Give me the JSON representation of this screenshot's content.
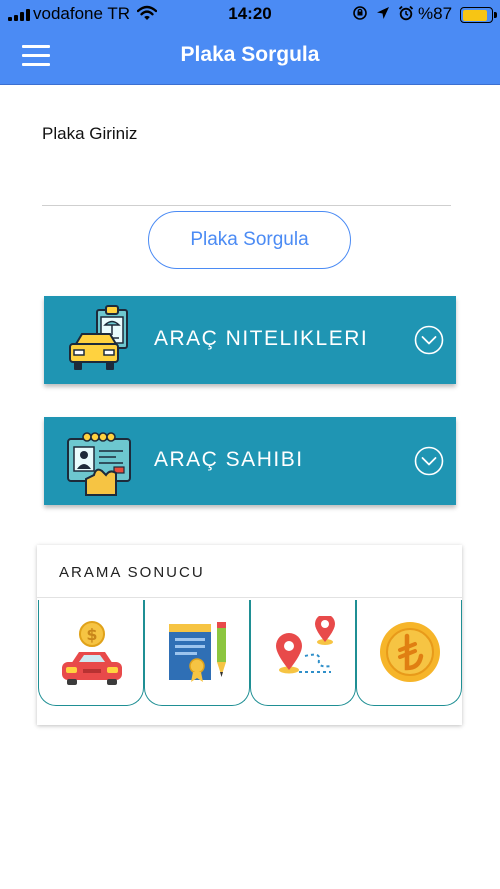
{
  "status_bar": {
    "carrier": "vodafone TR",
    "time": "14:20",
    "battery_percent": "%87"
  },
  "app_bar": {
    "title": "Plaka Sorgula",
    "menu_icon": "hamburger-menu-icon"
  },
  "form": {
    "plate_label": "Plaka Giriniz",
    "plate_value": "",
    "query_button_label": "Plaka Sorgula"
  },
  "panels": [
    {
      "title": "ARAÇ NITELIKLERI",
      "icon": "vehicle-document-icon",
      "chevron": "chevron-down-circle-icon"
    },
    {
      "title": "ARAÇ SAHIBI",
      "icon": "id-card-icon",
      "chevron": "chevron-down-circle-icon"
    }
  ],
  "result": {
    "title": "ARAMA SONUCU",
    "tiles": [
      {
        "icon": "car-price-icon"
      },
      {
        "icon": "certificate-icon"
      },
      {
        "icon": "route-map-icon"
      },
      {
        "icon": "lira-coin-icon"
      }
    ]
  },
  "colors": {
    "primary": "#4b8bf4",
    "panel": "#1f95b3",
    "tile_border": "#1f8f94",
    "battery": "#f7c514"
  }
}
